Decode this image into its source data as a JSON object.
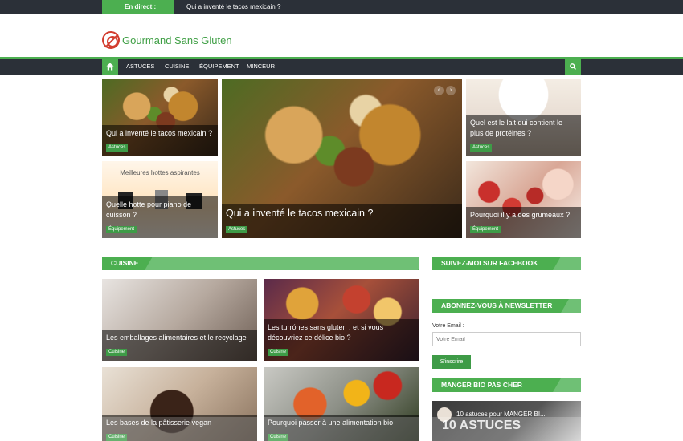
{
  "ticker": {
    "label": "En direct :",
    "text": "Qui a inventé le tacos mexicain ?"
  },
  "logo": {
    "text": "Gourmand Sans Gluten"
  },
  "nav": {
    "items": [
      {
        "label": "ASTUCES"
      },
      {
        "label": "CUISINE"
      },
      {
        "label": "ÉQUIPEMENT"
      },
      {
        "label": "MINCEUR"
      }
    ]
  },
  "featured": {
    "left_top": {
      "title": "Qui a inventé le tacos mexicain ?",
      "badge": "Astuces"
    },
    "left_bottom": {
      "image_text": "Meilleures hottes aspirantes",
      "title": "Quelle hotte pour piano de cuisson ?",
      "badge": "Équipement"
    },
    "center": {
      "title": "Qui a inventé le tacos mexicain ?",
      "badge": "Astuces"
    },
    "right_top": {
      "title": "Quel est le lait qui contient le plus de protéines ?",
      "badge": "Astuces"
    },
    "right_bottom": {
      "title": "Pourquoi il y a des grumeaux ?",
      "badge": "Équipement"
    },
    "arrows": {
      "prev": "‹",
      "next": "›"
    }
  },
  "cuisine": {
    "heading": "CUISINE",
    "posts": [
      {
        "title": "Les emballages alimentaires et le recyclage",
        "badge": "Cuisine"
      },
      {
        "title": "Les turrónes sans gluten : et si vous découvriez ce délice bio ?",
        "badge": "Cuisine"
      },
      {
        "title": "Les bases de la pâtisserie vegan",
        "badge": "Cuisine"
      },
      {
        "title": "Pourquoi passer à une alimentation bio",
        "badge": "Cuisine"
      }
    ]
  },
  "sidebar": {
    "facebook_heading": "SUIVEZ-MOI SUR FACEBOOK",
    "newsletter_heading": "ABONNEZ-VOUS À NEWSLETTER",
    "email_label": "Votre Email :",
    "email_placeholder": "Votre Email",
    "subscribe_label": "S'inscrire",
    "bio_heading": "MANGER BIO PAS CHER",
    "video_title": "10 astuces pour MANGER BI...",
    "video_overlay": "10 ASTUCES",
    "video_menu": "⋮"
  }
}
